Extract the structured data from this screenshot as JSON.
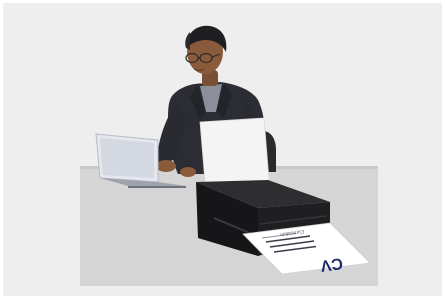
{
  "image": {
    "alt": "",
    "document": {
      "heading": "CV",
      "small_label": "Curriculum"
    },
    "colors": {
      "background": "#eeeeee",
      "desk": "#d4d4d4",
      "suit": "#2c2d34",
      "printer": "#1d1d1f",
      "laptop": "#dfe3ea",
      "cv_text": "#1c2b6b"
    }
  }
}
